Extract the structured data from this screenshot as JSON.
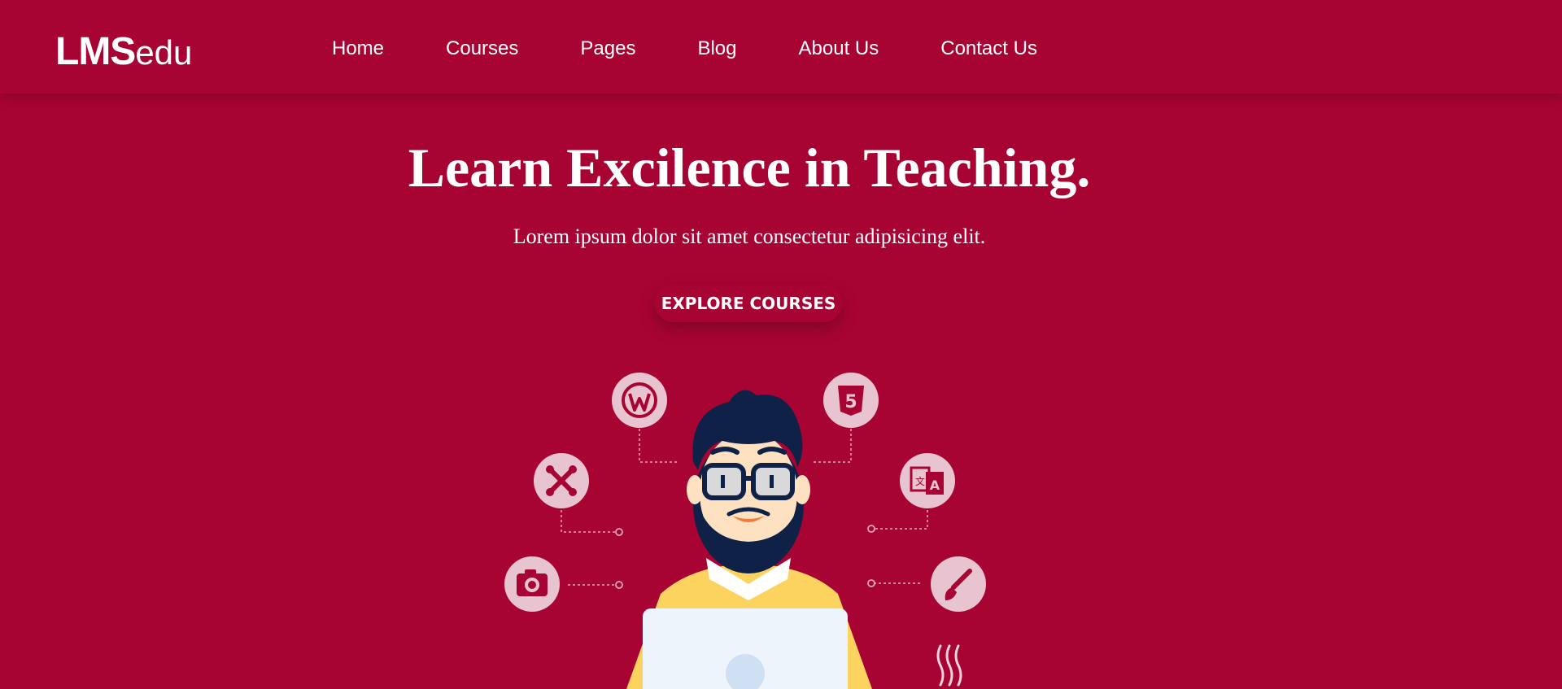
{
  "brand": {
    "logo_bold": "LMS",
    "logo_light": "edu"
  },
  "nav": {
    "items": [
      {
        "label": "Home"
      },
      {
        "label": "Courses"
      },
      {
        "label": "Pages"
      },
      {
        "label": "Blog"
      },
      {
        "label": "About Us"
      },
      {
        "label": "Contact Us"
      }
    ]
  },
  "hero": {
    "title": "Learn Excilence in Teaching.",
    "subtitle": "Lorem ipsum dolor sit amet consectetur adipisicing elit.",
    "cta_label": "EXPLORE COURSES"
  },
  "illustration": {
    "icons": [
      "wordpress-icon",
      "html5-icon",
      "joomla-icon",
      "translate-icon",
      "camera-icon",
      "paintbrush-icon"
    ],
    "html5_digit": "5"
  },
  "colors": {
    "brand_red": "#a80433",
    "icon_circle": "#e8c4d0",
    "shirt": "#fcd35e",
    "hair": "#0f2147",
    "skin": "#fde1c0"
  }
}
